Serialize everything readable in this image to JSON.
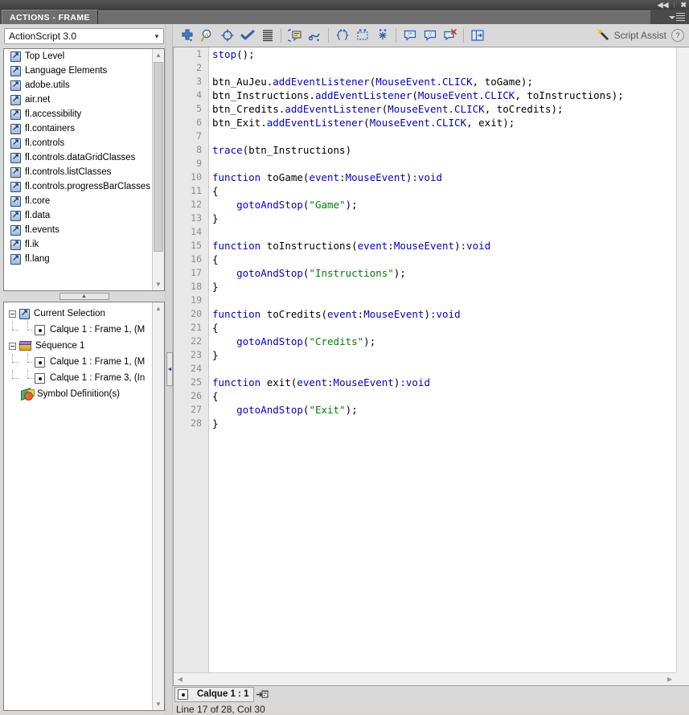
{
  "window": {
    "collapse_icon": "collapse-panel-icon",
    "close_icon": "close-icon"
  },
  "panel": {
    "tab_label": "ACTIONS - FRAME",
    "menu_icon": "panel-menu-icon"
  },
  "language_select": {
    "value": "ActionScript 3.0",
    "caret_icon": "chevron-down-icon"
  },
  "class_tree": {
    "items": [
      {
        "label": "Top Level",
        "icon": "package-icon"
      },
      {
        "label": "Language Elements",
        "icon": "package-icon"
      },
      {
        "label": "adobe.utils",
        "icon": "package-icon"
      },
      {
        "label": "air.net",
        "icon": "package-icon"
      },
      {
        "label": "fl.accessibility",
        "icon": "package-icon"
      },
      {
        "label": "fl.containers",
        "icon": "package-icon"
      },
      {
        "label": "fl.controls",
        "icon": "package-icon"
      },
      {
        "label": "fl.controls.dataGridClasses",
        "icon": "package-icon"
      },
      {
        "label": "fl.controls.listClasses",
        "icon": "package-icon"
      },
      {
        "label": "fl.controls.progressBarClasses",
        "icon": "package-icon"
      },
      {
        "label": "fl.core",
        "icon": "package-icon"
      },
      {
        "label": "fl.data",
        "icon": "package-icon"
      },
      {
        "label": "fl.events",
        "icon": "package-icon"
      },
      {
        "label": "fl.ik",
        "icon": "package-icon"
      },
      {
        "label": "fl.lang",
        "icon": "package-icon"
      }
    ],
    "scroll_up_icon": "chevron-up-icon",
    "scroll_down_icon": "chevron-down-icon"
  },
  "splitter": {
    "horizontal_icon": "triangle-up-icon",
    "vertical_icon": "triangle-left-icon"
  },
  "script_tree": {
    "items": [
      {
        "label": "Current Selection",
        "icon": "package-icon",
        "type": "root-selection"
      },
      {
        "label": "Calque 1 : Frame 1, (M",
        "icon": "frame-icon",
        "type": "child"
      },
      {
        "label": "Séquence 1",
        "icon": "scene-icon",
        "type": "root-scene"
      },
      {
        "label": "Calque 1 : Frame 1, (M",
        "icon": "frame-icon",
        "type": "child"
      },
      {
        "label": "Calque 1 : Frame 3, (In",
        "icon": "frame-icon",
        "type": "child"
      },
      {
        "label": "Symbol Definition(s)",
        "icon": "symbol-icon",
        "type": "symbol"
      }
    ],
    "scroll_up_icon": "chevron-up-icon",
    "scroll_down_icon": "chevron-down-icon"
  },
  "toolbar": {
    "buttons": [
      {
        "name": "add-item-button",
        "title": "Add a new item to the script"
      },
      {
        "name": "find-replace-button",
        "title": "Find"
      },
      {
        "name": "insert-target-path-button",
        "title": "Insert target path"
      },
      {
        "name": "check-syntax-button",
        "title": "Check syntax"
      },
      {
        "name": "auto-format-button",
        "title": "Auto format"
      },
      {
        "name": "show-code-hint-button",
        "title": "Show code hint"
      },
      {
        "name": "debug-options-button",
        "title": "Debug options"
      },
      {
        "name": "collapse-between-braces-button",
        "title": "Collapse between braces"
      },
      {
        "name": "collapse-selection-button",
        "title": "Collapse selection"
      },
      {
        "name": "expand-all-button",
        "title": "Expand all"
      },
      {
        "name": "apply-block-comment-button",
        "title": "Apply block comment"
      },
      {
        "name": "apply-line-comment-button",
        "title": "Apply line comment"
      },
      {
        "name": "remove-comment-button",
        "title": "Remove comment"
      },
      {
        "name": "show-hide-toolbox-button",
        "title": "Show/Hide Toolbox"
      }
    ],
    "script_assist_label": "Script Assist",
    "script_assist_icon": "magic-wand-icon",
    "help_label": "?",
    "help_icon": "help-icon"
  },
  "editor": {
    "total_lines": 28,
    "lines": [
      {
        "n": "1",
        "tokens": [
          {
            "t": "stop",
            "c": "kw"
          },
          {
            "t": "();",
            "c": "id"
          }
        ]
      },
      {
        "n": "2",
        "tokens": []
      },
      {
        "n": "3",
        "tokens": [
          {
            "t": "btn_AuJeu.",
            "c": "id"
          },
          {
            "t": "addEventListener",
            "c": "kw"
          },
          {
            "t": "(",
            "c": "id"
          },
          {
            "t": "MouseEvent.CLICK",
            "c": "kw"
          },
          {
            "t": ", toGame);",
            "c": "id"
          }
        ]
      },
      {
        "n": "4",
        "tokens": [
          {
            "t": "btn_Instructions.",
            "c": "id"
          },
          {
            "t": "addEventListener",
            "c": "kw"
          },
          {
            "t": "(",
            "c": "id"
          },
          {
            "t": "MouseEvent.CLICK",
            "c": "kw"
          },
          {
            "t": ", toInstructions);",
            "c": "id"
          }
        ]
      },
      {
        "n": "5",
        "tokens": [
          {
            "t": "btn_Credits.",
            "c": "id"
          },
          {
            "t": "addEventListener",
            "c": "kw"
          },
          {
            "t": "(",
            "c": "id"
          },
          {
            "t": "MouseEvent.CLICK",
            "c": "kw"
          },
          {
            "t": ", toCredits);",
            "c": "id"
          }
        ]
      },
      {
        "n": "6",
        "tokens": [
          {
            "t": "btn_Exit.",
            "c": "id"
          },
          {
            "t": "addEventListener",
            "c": "kw"
          },
          {
            "t": "(",
            "c": "id"
          },
          {
            "t": "MouseEvent.CLICK",
            "c": "kw"
          },
          {
            "t": ", exit);",
            "c": "id"
          }
        ]
      },
      {
        "n": "7",
        "tokens": []
      },
      {
        "n": "8",
        "tokens": [
          {
            "t": "trace",
            "c": "kw"
          },
          {
            "t": "(btn_Instructions)",
            "c": "id"
          }
        ]
      },
      {
        "n": "9",
        "tokens": []
      },
      {
        "n": "10",
        "tokens": [
          {
            "t": "function",
            "c": "kw"
          },
          {
            "t": " toGame(",
            "c": "id"
          },
          {
            "t": "event",
            "c": "kw"
          },
          {
            "t": ":",
            "c": "id"
          },
          {
            "t": "MouseEvent",
            "c": "kw"
          },
          {
            "t": ")",
            "c": "id"
          },
          {
            "t": ":void",
            "c": "kw"
          }
        ]
      },
      {
        "n": "11",
        "tokens": [
          {
            "t": "{",
            "c": "id"
          }
        ]
      },
      {
        "n": "12",
        "tokens": [
          {
            "t": "    ",
            "c": "id"
          },
          {
            "t": "gotoAndStop",
            "c": "kw"
          },
          {
            "t": "(",
            "c": "id"
          },
          {
            "t": "\"Game\"",
            "c": "str"
          },
          {
            "t": ");",
            "c": "id"
          }
        ]
      },
      {
        "n": "13",
        "tokens": [
          {
            "t": "}",
            "c": "id"
          }
        ]
      },
      {
        "n": "14",
        "tokens": []
      },
      {
        "n": "15",
        "tokens": [
          {
            "t": "function",
            "c": "kw"
          },
          {
            "t": " toInstructions(",
            "c": "id"
          },
          {
            "t": "event",
            "c": "kw"
          },
          {
            "t": ":",
            "c": "id"
          },
          {
            "t": "MouseEvent",
            "c": "kw"
          },
          {
            "t": ")",
            "c": "id"
          },
          {
            "t": ":void",
            "c": "kw"
          }
        ]
      },
      {
        "n": "16",
        "tokens": [
          {
            "t": "{",
            "c": "id"
          }
        ]
      },
      {
        "n": "17",
        "tokens": [
          {
            "t": "    ",
            "c": "id"
          },
          {
            "t": "gotoAndStop",
            "c": "kw"
          },
          {
            "t": "(",
            "c": "id"
          },
          {
            "t": "\"Instructions\"",
            "c": "str"
          },
          {
            "t": ");",
            "c": "id"
          }
        ]
      },
      {
        "n": "18",
        "tokens": [
          {
            "t": "}",
            "c": "id"
          }
        ]
      },
      {
        "n": "19",
        "tokens": []
      },
      {
        "n": "20",
        "tokens": [
          {
            "t": "function",
            "c": "kw"
          },
          {
            "t": " toCredits(",
            "c": "id"
          },
          {
            "t": "event",
            "c": "kw"
          },
          {
            "t": ":",
            "c": "id"
          },
          {
            "t": "MouseEvent",
            "c": "kw"
          },
          {
            "t": ")",
            "c": "id"
          },
          {
            "t": ":void",
            "c": "kw"
          }
        ]
      },
      {
        "n": "21",
        "tokens": [
          {
            "t": "{",
            "c": "id"
          }
        ]
      },
      {
        "n": "22",
        "tokens": [
          {
            "t": "    ",
            "c": "id"
          },
          {
            "t": "gotoAndStop",
            "c": "kw"
          },
          {
            "t": "(",
            "c": "id"
          },
          {
            "t": "\"Credits\"",
            "c": "str"
          },
          {
            "t": ");",
            "c": "id"
          }
        ]
      },
      {
        "n": "23",
        "tokens": [
          {
            "t": "}",
            "c": "id"
          }
        ]
      },
      {
        "n": "24",
        "tokens": []
      },
      {
        "n": "25",
        "tokens": [
          {
            "t": "function",
            "c": "kw"
          },
          {
            "t": " exit(",
            "c": "id"
          },
          {
            "t": "event",
            "c": "kw"
          },
          {
            "t": ":",
            "c": "id"
          },
          {
            "t": "MouseEvent",
            "c": "kw"
          },
          {
            "t": ")",
            "c": "id"
          },
          {
            "t": ":void",
            "c": "kw"
          }
        ]
      },
      {
        "n": "26",
        "tokens": [
          {
            "t": "{",
            "c": "id"
          }
        ]
      },
      {
        "n": "27",
        "tokens": [
          {
            "t": "    ",
            "c": "id"
          },
          {
            "t": "gotoAndStop",
            "c": "kw"
          },
          {
            "t": "(",
            "c": "id"
          },
          {
            "t": "\"Exit\"",
            "c": "str"
          },
          {
            "t": ");",
            "c": "id"
          }
        ]
      },
      {
        "n": "28",
        "tokens": [
          {
            "t": "}",
            "c": "id"
          }
        ]
      }
    ]
  },
  "status": {
    "pin_tab_label": "Calque 1 : 1",
    "pin_tab_icon": "frame-icon",
    "pin_script_icon": "pin-script-icon",
    "line_info": "Line 17 of 28, Col 30",
    "scroll_left_icon": "chevron-left-icon",
    "scroll_right_icon": "chevron-right-icon"
  },
  "colors": {
    "keyword": "#0000cc",
    "string": "#008000",
    "identifier": "#000000",
    "panel_bg": "#d9d9d9",
    "editor_bg": "#ffffff",
    "gutter_bg": "#e8e8e8",
    "tab_bg": "#6e6e6e"
  }
}
